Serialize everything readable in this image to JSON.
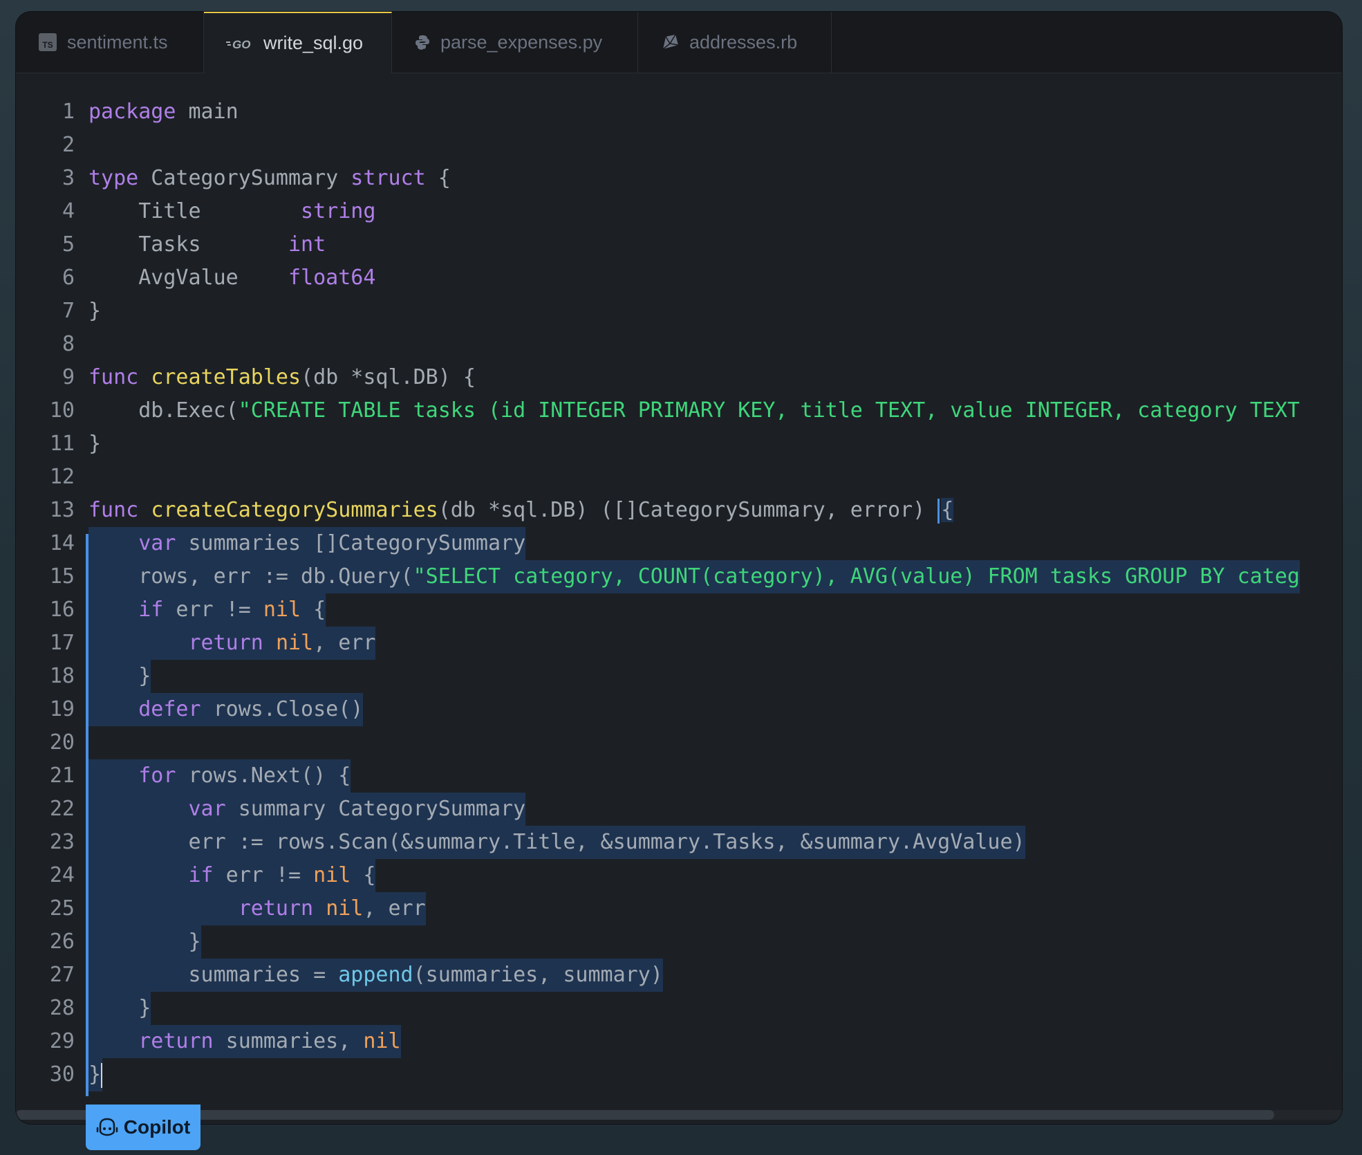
{
  "tabs": [
    {
      "label": "sentiment.ts",
      "icon": "typescript-icon",
      "active": false
    },
    {
      "label": "write_sql.go",
      "icon": "go-icon",
      "active": true
    },
    {
      "label": "parse_expenses.py",
      "icon": "python-icon",
      "active": false
    },
    {
      "label": "addresses.rb",
      "icon": "ruby-icon",
      "active": false
    }
  ],
  "editor": {
    "line_numbers": [
      "1",
      "2",
      "3",
      "4",
      "5",
      "6",
      "7",
      "8",
      "9",
      "10",
      "11",
      "12",
      "13",
      "14",
      "15",
      "16",
      "17",
      "18",
      "19",
      "20",
      "21",
      "22",
      "23",
      "24",
      "25",
      "26",
      "27",
      "28",
      "29",
      "30"
    ]
  },
  "code": {
    "l1": [
      "package",
      " main"
    ],
    "l3": [
      "type",
      " CategorySummary ",
      "struct",
      " {"
    ],
    "l4": [
      "    Title        ",
      "string"
    ],
    "l5": [
      "    Tasks       ",
      "int"
    ],
    "l6": [
      "    AvgValue    ",
      "float64"
    ],
    "l7": "}",
    "l9": [
      "func",
      " ",
      "createTables",
      "(db *sql.DB) {"
    ],
    "l10": [
      "    db.Exec(",
      "\"CREATE TABLE tasks (id INTEGER PRIMARY KEY, title TEXT, value INTEGER, category TEXT"
    ],
    "l11": "}",
    "l13": [
      "func",
      " ",
      "createCategorySummaries",
      "(db *sql.DB) ([]CategorySummary, error) ",
      "{"
    ],
    "l14": [
      "    ",
      "var",
      " summaries []CategorySummary"
    ],
    "l15": [
      "    rows, err := db.Query(",
      "\"SELECT category, COUNT(category), AVG(value) FROM tasks GROUP BY categ"
    ],
    "l16": [
      "    ",
      "if",
      " err != ",
      "nil",
      " {"
    ],
    "l17": [
      "        ",
      "return",
      " ",
      "nil",
      ", err"
    ],
    "l18": "    }",
    "l19": [
      "    ",
      "defer",
      " rows.Close()"
    ],
    "l21": [
      "    ",
      "for",
      " rows.Next() {"
    ],
    "l22": [
      "        ",
      "var",
      " summary CategorySummary"
    ],
    "l23": "        err := rows.Scan(&summary.Title, &summary.Tasks, &summary.AvgValue)",
    "l24": [
      "        ",
      "if",
      " err != ",
      "nil",
      " {"
    ],
    "l25": [
      "            ",
      "return",
      " ",
      "nil",
      ", err"
    ],
    "l26": "        }",
    "l27": [
      "        summaries = ",
      "append",
      "(summaries, summary)"
    ],
    "l28": "    }",
    "l29": [
      "    ",
      "return",
      " summaries, ",
      "nil"
    ],
    "l30": "}"
  },
  "copilot": {
    "label": "Copilot",
    "icon": "copilot-icon"
  },
  "colors": {
    "keyword": "#b07fe8",
    "function": "#e9d55e",
    "string": "#3fd67a",
    "nil": "#f0a15a",
    "builtin": "#6fc8e8",
    "selection": "#1e3350",
    "accent": "#4da3f5",
    "active_tab_border": "#e8c94a"
  }
}
